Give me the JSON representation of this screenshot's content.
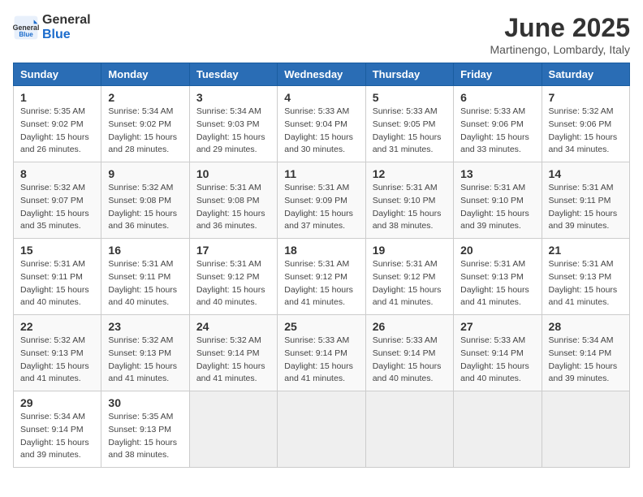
{
  "logo": {
    "text_general": "General",
    "text_blue": "Blue"
  },
  "title": "June 2025",
  "subtitle": "Martinengo, Lombardy, Italy",
  "headers": [
    "Sunday",
    "Monday",
    "Tuesday",
    "Wednesday",
    "Thursday",
    "Friday",
    "Saturday"
  ],
  "weeks": [
    [
      {
        "day": "1",
        "info": "Sunrise: 5:35 AM\nSunset: 9:02 PM\nDaylight: 15 hours\nand 26 minutes."
      },
      {
        "day": "2",
        "info": "Sunrise: 5:34 AM\nSunset: 9:02 PM\nDaylight: 15 hours\nand 28 minutes."
      },
      {
        "day": "3",
        "info": "Sunrise: 5:34 AM\nSunset: 9:03 PM\nDaylight: 15 hours\nand 29 minutes."
      },
      {
        "day": "4",
        "info": "Sunrise: 5:33 AM\nSunset: 9:04 PM\nDaylight: 15 hours\nand 30 minutes."
      },
      {
        "day": "5",
        "info": "Sunrise: 5:33 AM\nSunset: 9:05 PM\nDaylight: 15 hours\nand 31 minutes."
      },
      {
        "day": "6",
        "info": "Sunrise: 5:33 AM\nSunset: 9:06 PM\nDaylight: 15 hours\nand 33 minutes."
      },
      {
        "day": "7",
        "info": "Sunrise: 5:32 AM\nSunset: 9:06 PM\nDaylight: 15 hours\nand 34 minutes."
      }
    ],
    [
      {
        "day": "8",
        "info": "Sunrise: 5:32 AM\nSunset: 9:07 PM\nDaylight: 15 hours\nand 35 minutes."
      },
      {
        "day": "9",
        "info": "Sunrise: 5:32 AM\nSunset: 9:08 PM\nDaylight: 15 hours\nand 36 minutes."
      },
      {
        "day": "10",
        "info": "Sunrise: 5:31 AM\nSunset: 9:08 PM\nDaylight: 15 hours\nand 36 minutes."
      },
      {
        "day": "11",
        "info": "Sunrise: 5:31 AM\nSunset: 9:09 PM\nDaylight: 15 hours\nand 37 minutes."
      },
      {
        "day": "12",
        "info": "Sunrise: 5:31 AM\nSunset: 9:10 PM\nDaylight: 15 hours\nand 38 minutes."
      },
      {
        "day": "13",
        "info": "Sunrise: 5:31 AM\nSunset: 9:10 PM\nDaylight: 15 hours\nand 39 minutes."
      },
      {
        "day": "14",
        "info": "Sunrise: 5:31 AM\nSunset: 9:11 PM\nDaylight: 15 hours\nand 39 minutes."
      }
    ],
    [
      {
        "day": "15",
        "info": "Sunrise: 5:31 AM\nSunset: 9:11 PM\nDaylight: 15 hours\nand 40 minutes."
      },
      {
        "day": "16",
        "info": "Sunrise: 5:31 AM\nSunset: 9:11 PM\nDaylight: 15 hours\nand 40 minutes."
      },
      {
        "day": "17",
        "info": "Sunrise: 5:31 AM\nSunset: 9:12 PM\nDaylight: 15 hours\nand 40 minutes."
      },
      {
        "day": "18",
        "info": "Sunrise: 5:31 AM\nSunset: 9:12 PM\nDaylight: 15 hours\nand 41 minutes."
      },
      {
        "day": "19",
        "info": "Sunrise: 5:31 AM\nSunset: 9:12 PM\nDaylight: 15 hours\nand 41 minutes."
      },
      {
        "day": "20",
        "info": "Sunrise: 5:31 AM\nSunset: 9:13 PM\nDaylight: 15 hours\nand 41 minutes."
      },
      {
        "day": "21",
        "info": "Sunrise: 5:31 AM\nSunset: 9:13 PM\nDaylight: 15 hours\nand 41 minutes."
      }
    ],
    [
      {
        "day": "22",
        "info": "Sunrise: 5:32 AM\nSunset: 9:13 PM\nDaylight: 15 hours\nand 41 minutes."
      },
      {
        "day": "23",
        "info": "Sunrise: 5:32 AM\nSunset: 9:13 PM\nDaylight: 15 hours\nand 41 minutes."
      },
      {
        "day": "24",
        "info": "Sunrise: 5:32 AM\nSunset: 9:14 PM\nDaylight: 15 hours\nand 41 minutes."
      },
      {
        "day": "25",
        "info": "Sunrise: 5:33 AM\nSunset: 9:14 PM\nDaylight: 15 hours\nand 41 minutes."
      },
      {
        "day": "26",
        "info": "Sunrise: 5:33 AM\nSunset: 9:14 PM\nDaylight: 15 hours\nand 40 minutes."
      },
      {
        "day": "27",
        "info": "Sunrise: 5:33 AM\nSunset: 9:14 PM\nDaylight: 15 hours\nand 40 minutes."
      },
      {
        "day": "28",
        "info": "Sunrise: 5:34 AM\nSunset: 9:14 PM\nDaylight: 15 hours\nand 39 minutes."
      }
    ],
    [
      {
        "day": "29",
        "info": "Sunrise: 5:34 AM\nSunset: 9:14 PM\nDaylight: 15 hours\nand 39 minutes."
      },
      {
        "day": "30",
        "info": "Sunrise: 5:35 AM\nSunset: 9:13 PM\nDaylight: 15 hours\nand 38 minutes."
      },
      {
        "day": "",
        "info": ""
      },
      {
        "day": "",
        "info": ""
      },
      {
        "day": "",
        "info": ""
      },
      {
        "day": "",
        "info": ""
      },
      {
        "day": "",
        "info": ""
      }
    ]
  ]
}
